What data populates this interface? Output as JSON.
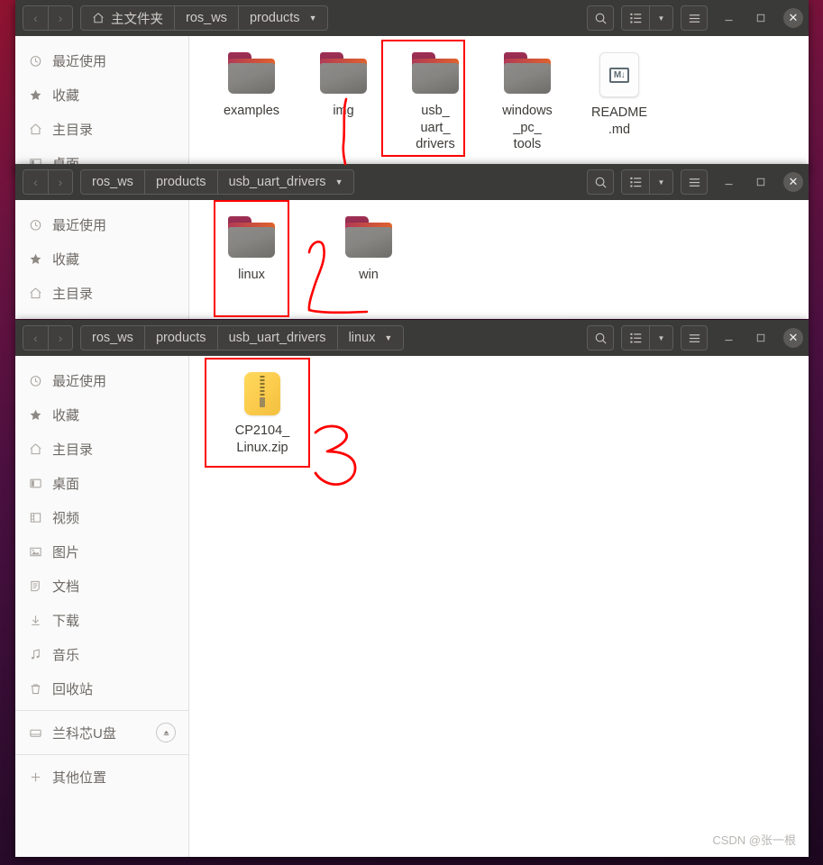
{
  "desktop": {
    "background_top": "#8f1330",
    "background_bottom": "#1d0820",
    "watermark": "CSDN @张一根"
  },
  "icons": {
    "back": "‹",
    "forward": "›",
    "caret_down": "▼",
    "search": "search-icon",
    "list_view": "list-view-icon",
    "menu": "hamburger-menu-icon",
    "minimize": "_",
    "maximize": "□",
    "close": "✕",
    "eject": "▲",
    "plus": "+",
    "home": "⌂"
  },
  "sidebar_items": [
    {
      "label": "最近使用",
      "icon": "clock-icon"
    },
    {
      "label": "收藏",
      "icon": "star-icon"
    },
    {
      "label": "主目录",
      "icon": "home-icon"
    },
    {
      "label": "桌面",
      "icon": "desktop-icon"
    },
    {
      "label": "视频",
      "icon": "video-icon"
    },
    {
      "label": "图片",
      "icon": "picture-icon"
    },
    {
      "label": "文档",
      "icon": "document-icon"
    },
    {
      "label": "下载",
      "icon": "download-icon"
    },
    {
      "label": "音乐",
      "icon": "music-icon"
    },
    {
      "label": "回收站",
      "icon": "trash-icon"
    }
  ],
  "device": {
    "label": "兰科芯U盘",
    "icon": "drive-icon",
    "eject_label": "⏏"
  },
  "other_locations": {
    "label": "其他位置",
    "icon": "plus-icon"
  },
  "windows": [
    {
      "id": "window-products",
      "breadcrumbs": [
        {
          "label": "主文件夹",
          "has_home_icon": true,
          "has_caret": false
        },
        {
          "label": "ros_ws",
          "has_home_icon": false,
          "has_caret": false
        },
        {
          "label": "products",
          "has_home_icon": false,
          "has_caret": true
        }
      ],
      "sidebar_count": 4,
      "files": [
        {
          "name": "examples",
          "type": "folder",
          "selected": false
        },
        {
          "name": "img",
          "type": "folder",
          "selected": false
        },
        {
          "name": "usb_\nuart_\ndrivers",
          "type": "folder",
          "selected": true
        },
        {
          "name": "windows\n_pc_\ntools",
          "type": "folder",
          "selected": false
        },
        {
          "name": "README\n.md",
          "type": "markdown",
          "selected": false
        }
      ],
      "annotation_number": "1"
    },
    {
      "id": "window-usb-uart-drivers",
      "breadcrumbs": [
        {
          "label": "ros_ws",
          "has_home_icon": false,
          "has_caret": false
        },
        {
          "label": "products",
          "has_home_icon": false,
          "has_caret": false
        },
        {
          "label": "usb_uart_drivers",
          "has_home_icon": false,
          "has_caret": true
        }
      ],
      "sidebar_count": 3,
      "files": [
        {
          "name": "linux",
          "type": "folder",
          "selected": true
        },
        {
          "name": "win",
          "type": "folder",
          "selected": false
        }
      ],
      "annotation_number": "2"
    },
    {
      "id": "window-linux",
      "breadcrumbs": [
        {
          "label": "ros_ws",
          "has_home_icon": false,
          "has_caret": false
        },
        {
          "label": "products",
          "has_home_icon": false,
          "has_caret": false
        },
        {
          "label": "usb_uart_drivers",
          "has_home_icon": false,
          "has_caret": false
        },
        {
          "label": "linux",
          "has_home_icon": false,
          "has_caret": true
        }
      ],
      "sidebar_count": 10,
      "files": [
        {
          "name": "CP2104_\nLinux.zip",
          "type": "zip",
          "selected": true
        }
      ],
      "annotation_number": "3"
    }
  ],
  "annotation_color": "#fe0000"
}
